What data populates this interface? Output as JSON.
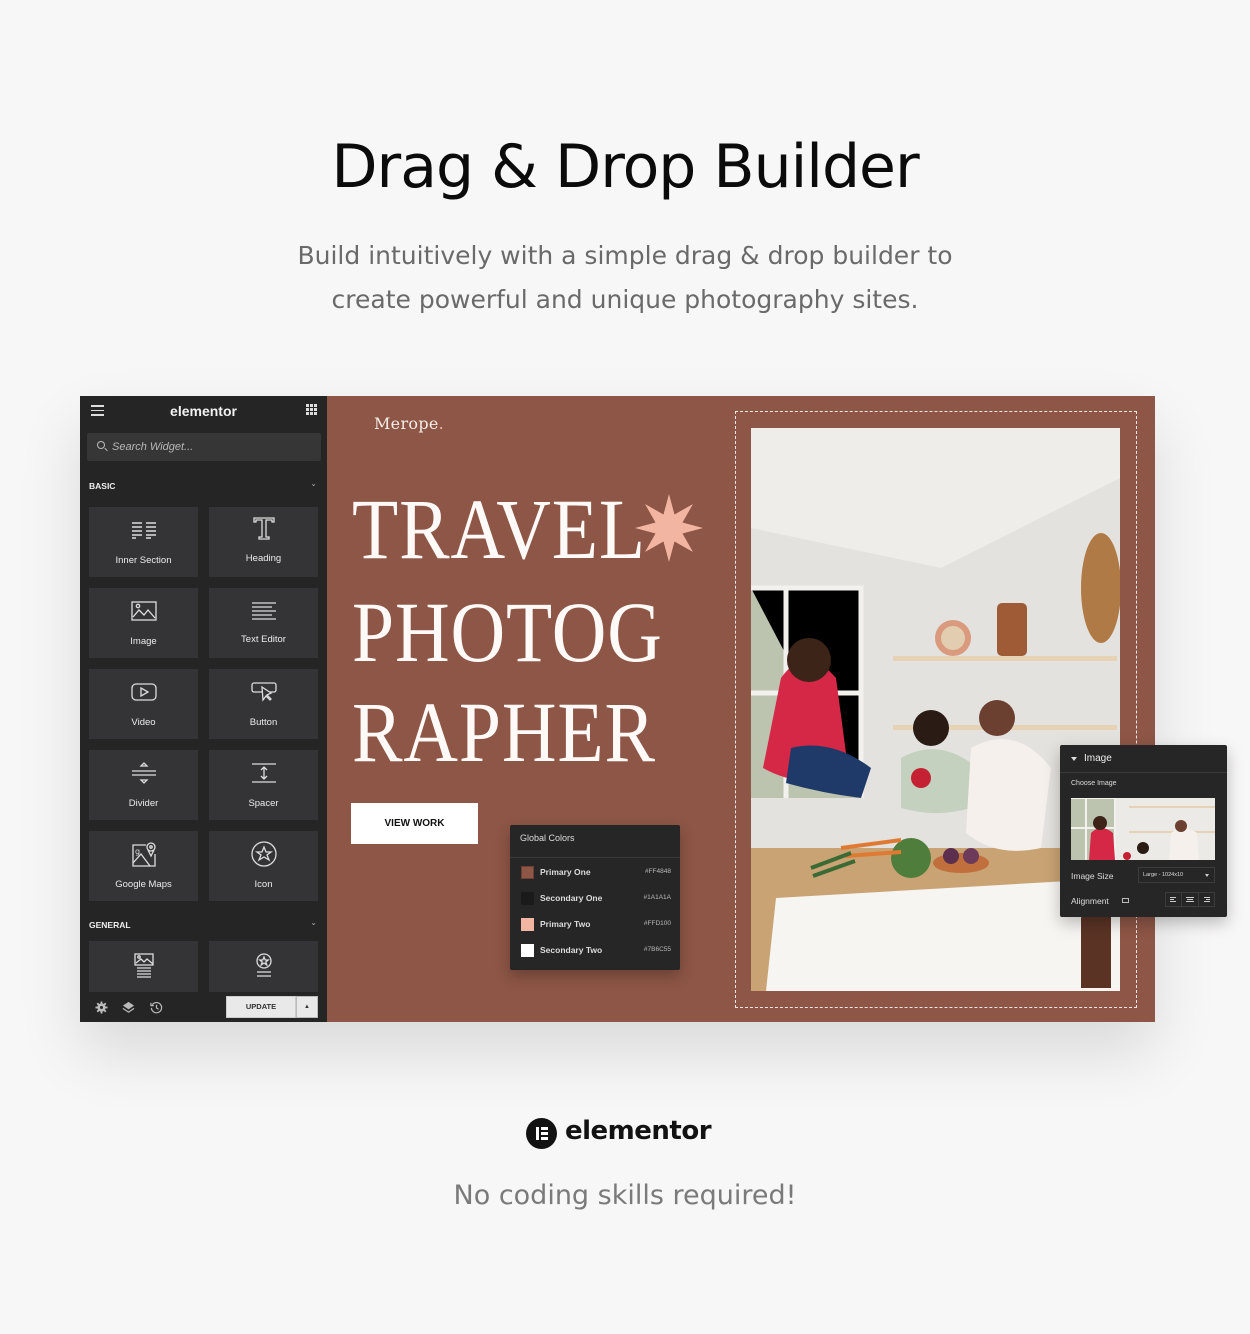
{
  "hero": {
    "title": "Drag & Drop Builder",
    "subtitle_lines": [
      "Build intuitively with a simple drag & drop builder to",
      "create powerful and unique photography sites."
    ]
  },
  "editor": {
    "sidebar": {
      "logo": "elementor",
      "menu_icon": "hamburger-icon",
      "apps_icon": "grid-icon",
      "search_placeholder": "Search Widget...",
      "sections": [
        {
          "label": "BASIC",
          "widgets": [
            {
              "label": "Inner Section",
              "icon": "inner-section-icon"
            },
            {
              "label": "Heading",
              "icon": "heading-icon"
            },
            {
              "label": "Image",
              "icon": "image-icon"
            },
            {
              "label": "Text Editor",
              "icon": "text-editor-icon"
            },
            {
              "label": "Video",
              "icon": "video-icon"
            },
            {
              "label": "Button",
              "icon": "button-icon"
            },
            {
              "label": "Divider",
              "icon": "divider-icon"
            },
            {
              "label": "Spacer",
              "icon": "spacer-icon"
            },
            {
              "label": "Google Maps",
              "icon": "google-maps-icon"
            },
            {
              "label": "Icon",
              "icon": "star-icon"
            }
          ]
        },
        {
          "label": "GENERAL",
          "widgets": [
            {
              "label": "",
              "icon": "image-box-icon"
            },
            {
              "label": "",
              "icon": "icon-box-icon"
            }
          ]
        }
      ],
      "footer": {
        "icons": [
          "settings-icon",
          "layers-icon",
          "history-icon"
        ],
        "update_label": "UPDATE"
      }
    },
    "canvas": {
      "brand": "Merope",
      "brand_dot": ".",
      "headline_lines": [
        "TRAVEL",
        "PHOTOG",
        "RAPHER"
      ],
      "cta_label": "VIEW WORK",
      "background_color": "#8D5646",
      "accent_color": "#F2B5A1"
    },
    "global_colors": {
      "title": "Global Colors",
      "items": [
        {
          "name": "Primary One",
          "hex": "#FF4848",
          "swatch": "#8D5646"
        },
        {
          "name": "Secondary One",
          "hex": "#1A1A1A",
          "swatch": "#1A1A1A"
        },
        {
          "name": "Primary Two",
          "hex": "#FFD100",
          "swatch": "#F2B5A1"
        },
        {
          "name": "Secondary Two",
          "hex": "#7B6C55",
          "swatch": "#FFFFFF"
        }
      ]
    },
    "image_panel": {
      "title": "Image",
      "choose_label": "Choose Image",
      "size_label": "Image Size",
      "size_value": "Large - 1024x10",
      "alignment_label": "Alignment"
    }
  },
  "footer": {
    "logo_word": "elementor",
    "tagline": "No coding skills required!"
  }
}
